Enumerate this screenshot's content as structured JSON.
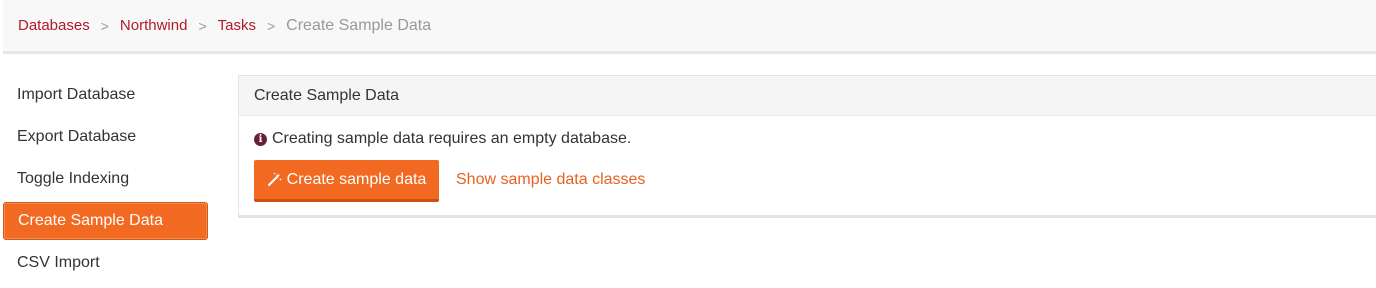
{
  "breadcrumb": {
    "items": [
      "Databases",
      "Northwind",
      "Tasks"
    ],
    "current": "Create Sample Data",
    "separator": ">"
  },
  "sidebar": {
    "items": [
      {
        "label": "Import Database"
      },
      {
        "label": "Export Database"
      },
      {
        "label": "Toggle Indexing"
      },
      {
        "label": "Create Sample Data",
        "active": true
      },
      {
        "label": "CSV Import"
      }
    ]
  },
  "panel": {
    "title": "Create Sample Data",
    "info_icon": "info-circle-icon",
    "info_text": "Creating sample data requires an empty database.",
    "create_button_icon": "magic-wand-icon",
    "create_button_label": "Create sample data",
    "show_classes_link": "Show sample data classes"
  },
  "colors": {
    "accent": "#f26a21",
    "breadcrumb_link": "#b11a2a",
    "link": "#e6621f",
    "info_icon": "#6b1f3a"
  }
}
